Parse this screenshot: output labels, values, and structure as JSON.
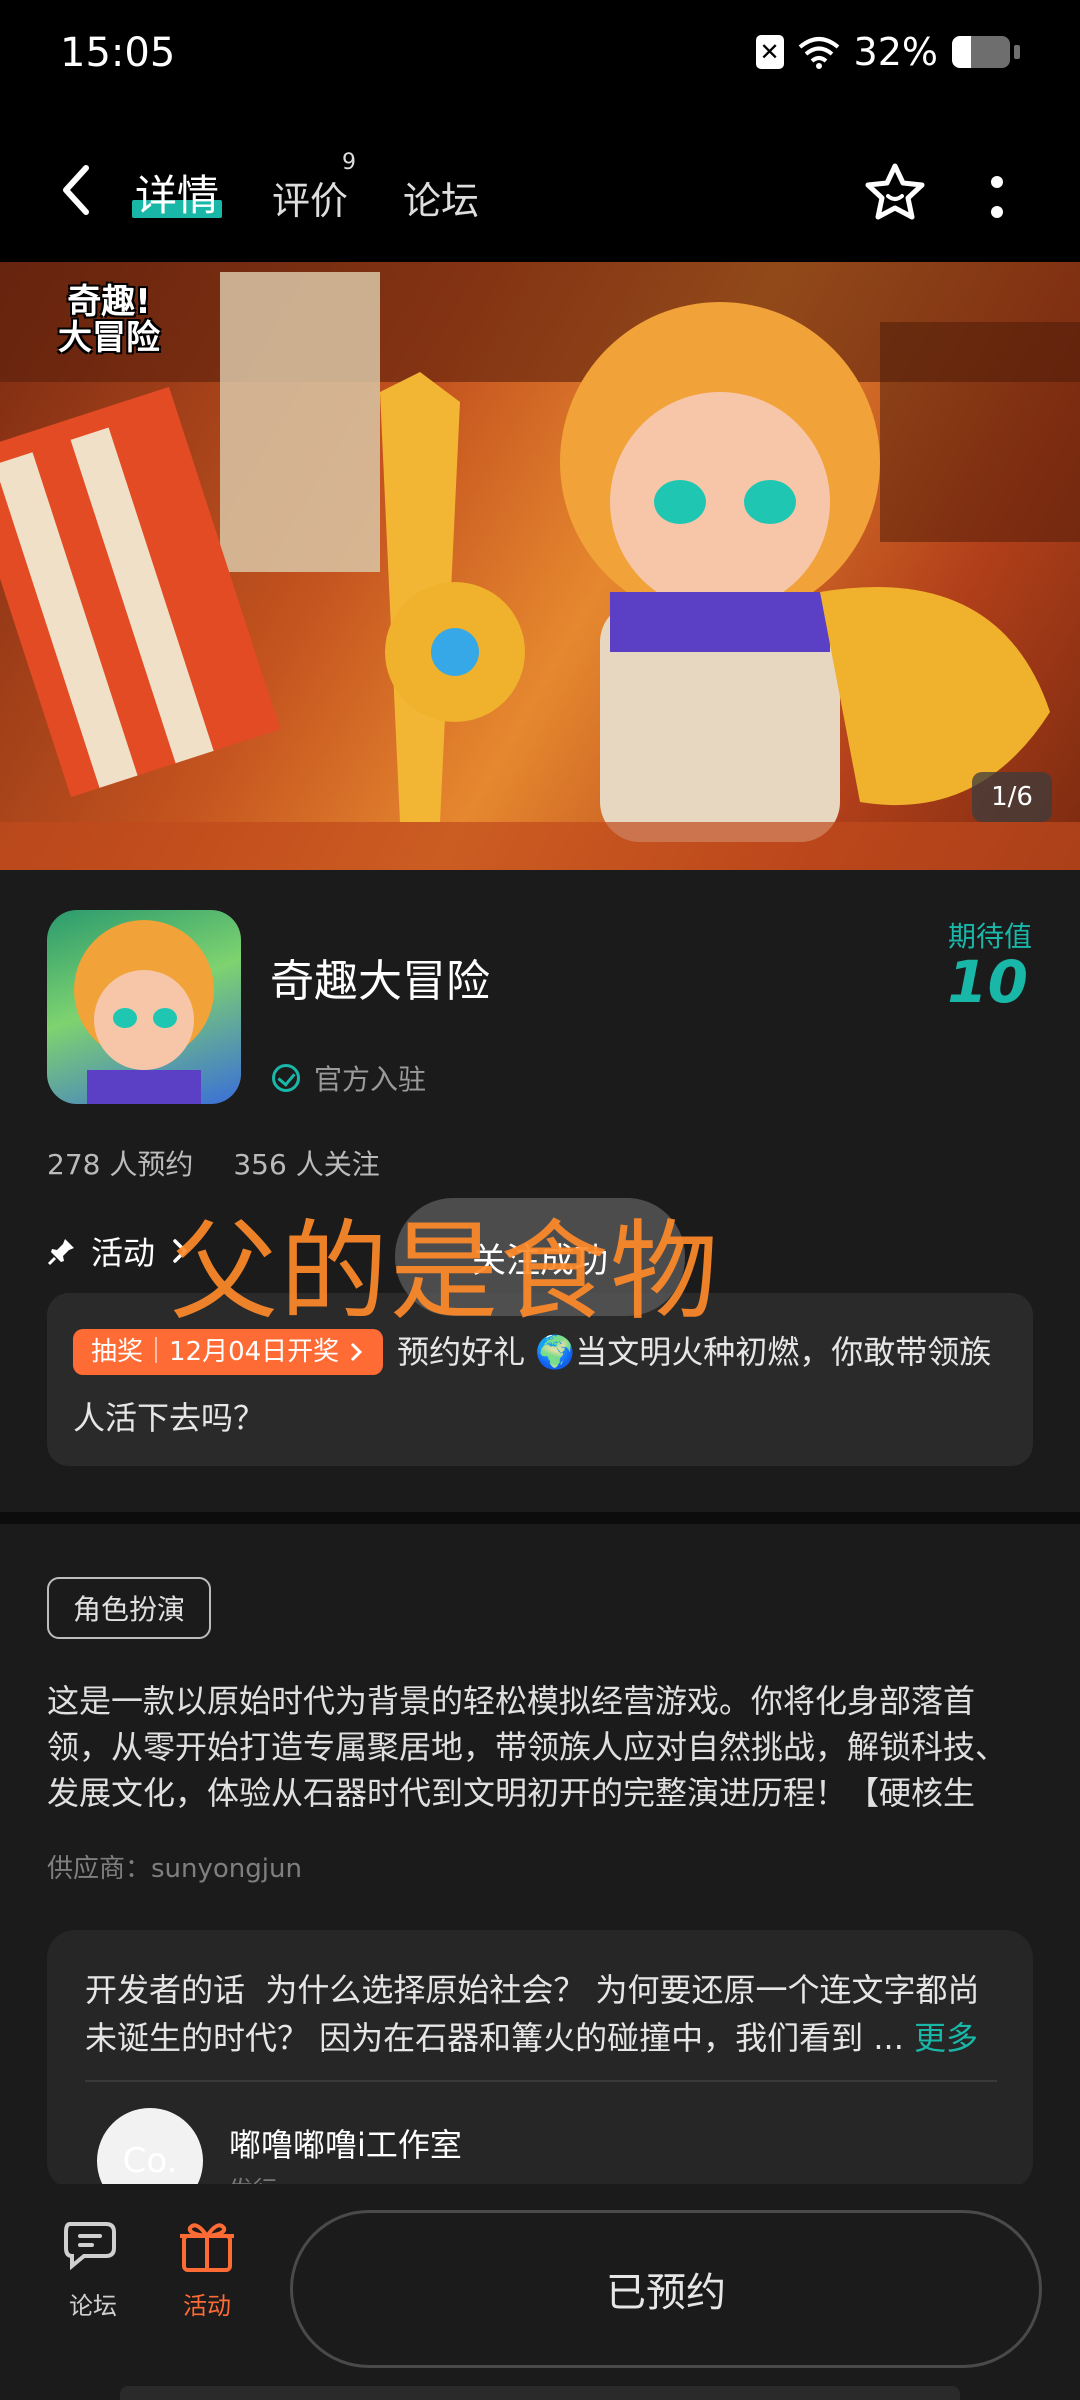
{
  "status_bar": {
    "time": "15:05",
    "battery": "32%",
    "battery_level": 0.32
  },
  "top_nav": {
    "tabs": [
      {
        "label": "详情"
      },
      {
        "label": "评价",
        "badge": "9"
      },
      {
        "label": "论坛"
      }
    ]
  },
  "banner": {
    "logo_text": "奇趣!大冒险",
    "pager": "1/6"
  },
  "game": {
    "name": "奇趣大冒险",
    "verified": "官方入驻",
    "expect_label": "期待值",
    "expect_value": "10",
    "reservations": "278 人预约",
    "followers": "356 人关注"
  },
  "activity": {
    "header": "活动",
    "tag": "抽奖｜12月04日开奖",
    "text": "预约好礼 🌍当文明火种初燃，你敢带领族人活下去吗？"
  },
  "toast": "关注成功",
  "overlay_text": "父的是食物",
  "genre_tag": "角色扮演",
  "description": "这是一款以原始时代为背景的轻松模拟经营游戏。你将化身部落首领，从零开始打造专属聚居地，带领族人应对自然挑战，解锁科技、发展文化，体验从石器时代到文明初开的完整演进历程！【硬核生存，…",
  "supplier": "供应商：sunyongjun",
  "developer": {
    "heading": "开发者的话",
    "text": "为什么选择原始社会？ 为何要还原一个连文字都尚未诞生的时代？ 因为在石器和篝火的碰撞中，我们看到 ...",
    "more": "更多",
    "avatar_text": "Co.",
    "name": "嘟噜嘟噜i工作室",
    "role": "发行"
  },
  "bottom_bar": {
    "forum": "论坛",
    "activity": "活动",
    "reserve_button": "已预约"
  },
  "colors": {
    "accent": "#19b7a8",
    "orange": "#ff6b35",
    "overlay_orange": "#ff8a2a"
  }
}
